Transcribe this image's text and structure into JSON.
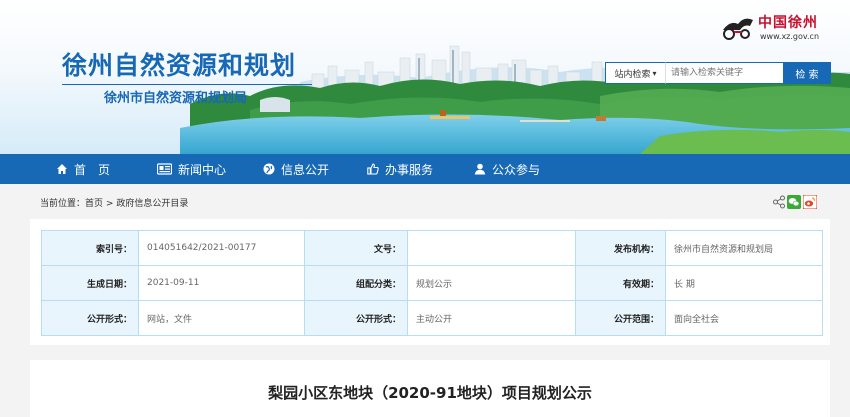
{
  "header": {
    "site_title": "徐州自然资源和规划",
    "site_subtitle": "徐州市自然资源和规划局",
    "logo_name": "中国徐州",
    "logo_url": "www.xz.gov.cn"
  },
  "search": {
    "scope_label": "站内检索",
    "placeholder": "请输入检索关键字",
    "button_label": "检 索"
  },
  "nav": {
    "home": "首　页",
    "news": "新闻中心",
    "public_info": "信息公开",
    "services": "办事服务",
    "participation": "公众参与"
  },
  "breadcrumb": {
    "prefix": "当前位置：",
    "home": "首页",
    "separator": ">",
    "current": "政府信息公开目录"
  },
  "info": {
    "rows": [
      [
        {
          "label": "索引号：",
          "value": "014051642/2021-00177"
        },
        {
          "label": "文号：",
          "value": ""
        },
        {
          "label": "发布机构：",
          "value": "徐州市自然资源和规划局"
        }
      ],
      [
        {
          "label": "生成日期：",
          "value": "2021-09-11"
        },
        {
          "label": "组配分类：",
          "value": "规划公示"
        },
        {
          "label": "有效期：",
          "value": "长 期"
        }
      ],
      [
        {
          "label": "公开形式：",
          "value": "网站，文件"
        },
        {
          "label": "公开形式：",
          "value": "主动公开"
        },
        {
          "label": "公开范围：",
          "value": "面向全社会"
        }
      ]
    ]
  },
  "article": {
    "title": "梨园小区东地块（2020-91地块）项目规划公示"
  },
  "colors": {
    "brand_blue": "#1768b5",
    "label_bg": "#e8f5fd",
    "border": "#b8dcf1"
  }
}
